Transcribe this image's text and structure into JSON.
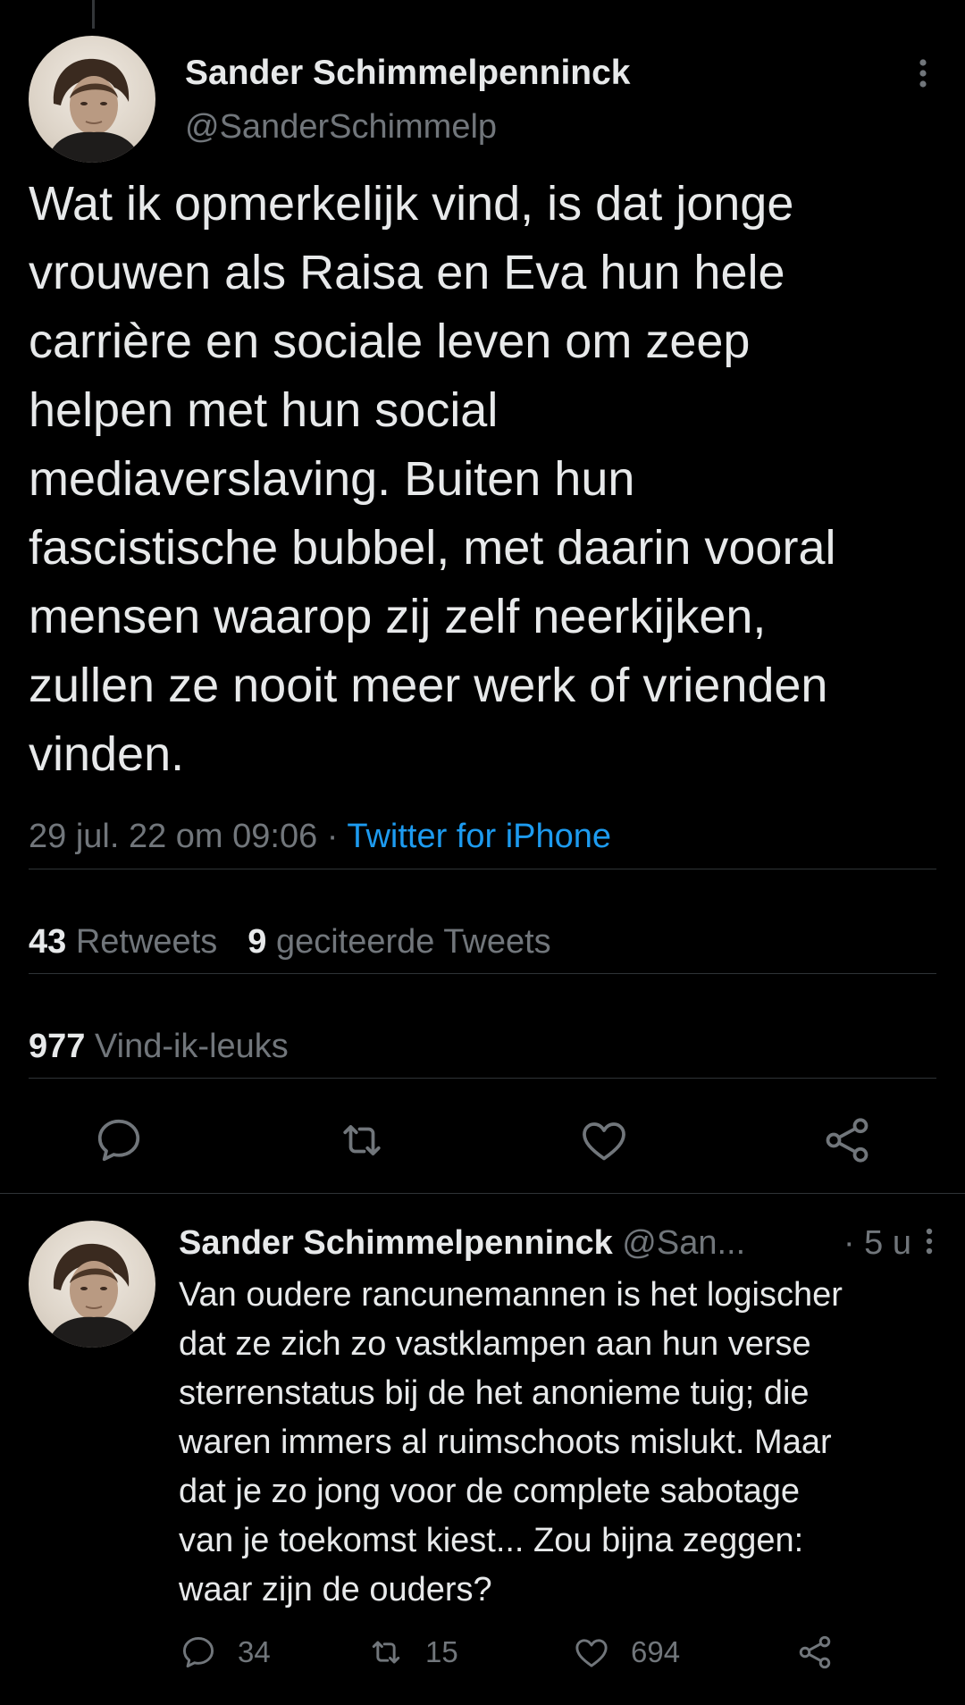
{
  "tweet": {
    "author_name": "Sander Schimmelpenninck",
    "author_handle": "@SanderSchimmelp",
    "text_lines": [
      "Wat ik opmerkelijk vind, is dat jonge",
      "vrouwen als Raisa en Eva hun hele",
      "carrière en sociale leven om zeep",
      "helpen met hun social",
      "mediaverslaving. Buiten hun",
      "fascistische bubbel, met daarin vooral",
      "mensen waarop zij zelf neerkijken,",
      "zullen ze nooit meer werk of vrienden",
      "vinden."
    ],
    "timestamp": "29 jul. 22 om 09:06",
    "separator": " · ",
    "source": "Twitter for iPhone",
    "retweets_count": "43",
    "retweets_label": "Retweets",
    "quotes_count": "9",
    "quotes_label": "geciteerde Tweets",
    "likes_count": "977",
    "likes_label": "Vind-ik-leuks"
  },
  "reply": {
    "author_name": "Sander Schimmelpenninck",
    "author_handle": "@San...",
    "time": "· 5 u",
    "text_lines": [
      "Van oudere rancunemannen is het logischer",
      "dat ze zich zo vastklampen aan hun verse",
      "sterrenstatus bij de het anonieme tuig; die",
      "waren immers al ruimschoots mislukt. Maar",
      "dat je zo jong voor de complete sabotage",
      "van je toekomst kiest... Zou bijna zeggen:",
      "waar zijn de ouders?"
    ],
    "reply_count": "34",
    "retweet_count": "15",
    "like_count": "694"
  },
  "icons": {
    "more": "more-vertical-icon",
    "reply": "reply-icon",
    "retweet": "retweet-icon",
    "like": "heart-icon",
    "share": "share-icon"
  },
  "colors": {
    "background": "#000000",
    "text": "#e7e9ea",
    "secondary": "#71767b",
    "link": "#1d9bf0",
    "divider": "#2f3336"
  }
}
